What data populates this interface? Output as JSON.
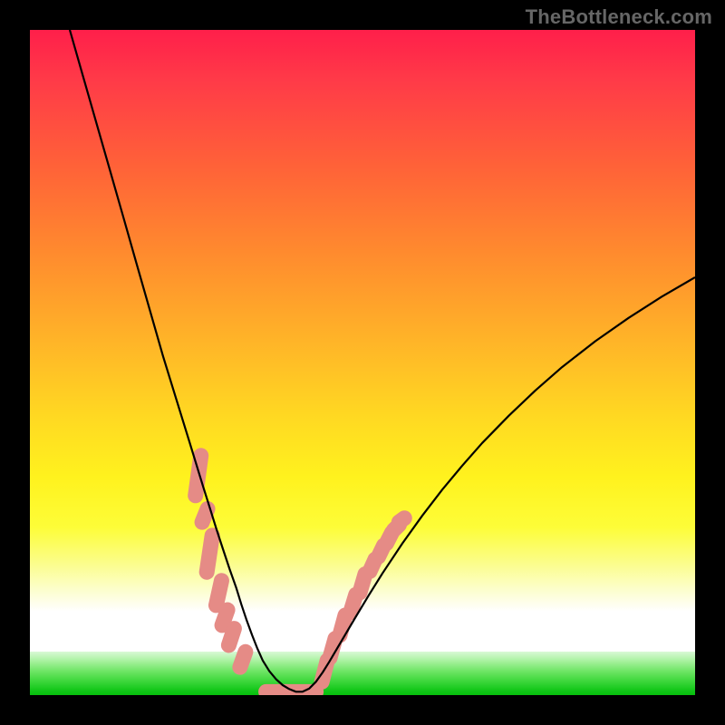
{
  "watermark": "TheBottleneck.com",
  "chart_data": {
    "type": "line",
    "title": "",
    "xlabel": "",
    "ylabel": "",
    "xlim": [
      0,
      100
    ],
    "ylim": [
      0,
      100
    ],
    "series": [
      {
        "name": "curve",
        "x": [
          6,
          8,
          10,
          12,
          14,
          16,
          18,
          20,
          22,
          24,
          26,
          27,
          28,
          29,
          30,
          31,
          31.8,
          32.6,
          33.4,
          34.2,
          35,
          36,
          37,
          38,
          39,
          40,
          41,
          42,
          43,
          44,
          45,
          47,
          49,
          51,
          53,
          56,
          59,
          62,
          65,
          68,
          72,
          76,
          80,
          85,
          90,
          95,
          100
        ],
        "y": [
          100,
          93,
          86,
          79,
          72,
          65,
          58,
          51,
          44.5,
          38,
          31.5,
          28.3,
          25.1,
          22,
          19,
          16.2,
          13.6,
          11.2,
          9.0,
          7.0,
          5.2,
          3.6,
          2.4,
          1.5,
          0.9,
          0.5,
          0.5,
          1.0,
          2.0,
          3.4,
          5.0,
          8.4,
          11.8,
          15.1,
          18.3,
          22.8,
          27.0,
          30.9,
          34.5,
          37.9,
          42.0,
          45.8,
          49.3,
          53.2,
          56.7,
          59.9,
          62.8
        ]
      }
    ],
    "markers": {
      "name": "highlight-lozenges",
      "color": "#e58b86",
      "segments": [
        {
          "x": 25.3,
          "y0": 36.0,
          "y1": 30.0
        },
        {
          "x": 26.3,
          "y0": 28.0,
          "y1": 26.0
        },
        {
          "x": 27.0,
          "y0": 24.0,
          "y1": 18.5
        },
        {
          "x": 28.4,
          "y0": 17.2,
          "y1": 13.5
        },
        {
          "x": 29.3,
          "y0": 12.8,
          "y1": 10.5
        },
        {
          "x": 30.3,
          "y0": 10.0,
          "y1": 7.5
        },
        {
          "x": 32.0,
          "y0": 6.5,
          "y1": 4.2
        },
        {
          "x": 44.3,
          "y0": 2.0,
          "y1": 5.2
        },
        {
          "x": 45.5,
          "y0": 5.6,
          "y1": 8.5
        },
        {
          "x": 47.0,
          "y0": 9.0,
          "y1": 12.0
        },
        {
          "x": 48.6,
          "y0": 12.4,
          "y1": 15.1
        },
        {
          "x": 50.0,
          "y0": 15.4,
          "y1": 18.2
        },
        {
          "x": 51.5,
          "y0": 18.6,
          "y1": 20.4
        },
        {
          "x": 52.8,
          "y0": 20.8,
          "y1": 22.5
        },
        {
          "x": 54.0,
          "y0": 22.8,
          "y1": 24.4
        },
        {
          "x": 55.1,
          "y0": 24.8,
          "y1": 25.6
        },
        {
          "x": 55.9,
          "y0": 26.0,
          "y1": 26.6
        }
      ],
      "flat_bottom": {
        "x0": 35.5,
        "x1": 43.0,
        "y": 0.5
      }
    },
    "background_gradient": {
      "top": "#ff1f4a",
      "mid": "#ffd822",
      "bottom_band": "#06c00d"
    }
  }
}
